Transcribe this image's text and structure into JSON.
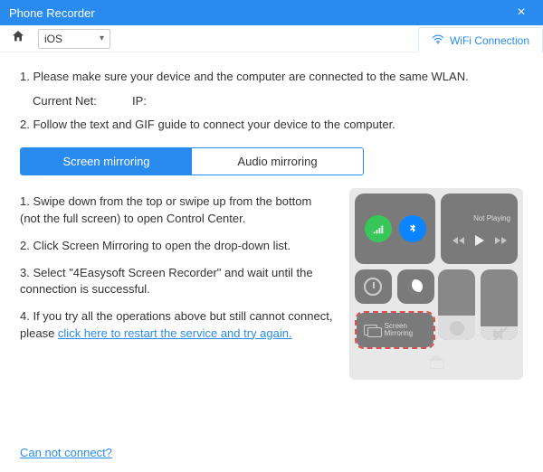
{
  "titlebar": {
    "title": "Phone Recorder"
  },
  "toolbar": {
    "device_selected": "iOS",
    "wifi_tab": "WiFi Connection"
  },
  "step1": "1. Please make sure your device and the computer are connected to the same WLAN.",
  "net": {
    "current_label": "Current Net:",
    "ip_label": "IP:"
  },
  "step2": "2. Follow the text and GIF guide to connect your device to the computer.",
  "tabs": {
    "screen": "Screen mirroring",
    "audio": "Audio mirroring"
  },
  "instructions": {
    "s1": "1. Swipe down from the top or swipe up from the bottom (not the full screen) to open Control Center.",
    "s2": "2. Click Screen Mirroring to open the drop-down list.",
    "s3": "3. Select \"4Easysoft Screen Recorder\" and wait until the connection is successful.",
    "s4_a": "4. If you try all the operations above but still cannot connect, please ",
    "s4_link": "click here to restart the service and try again."
  },
  "cc": {
    "not_playing": "Not Playing",
    "screen_mirroring": "Screen Mirroring"
  },
  "footer_link": "Can not connect?"
}
